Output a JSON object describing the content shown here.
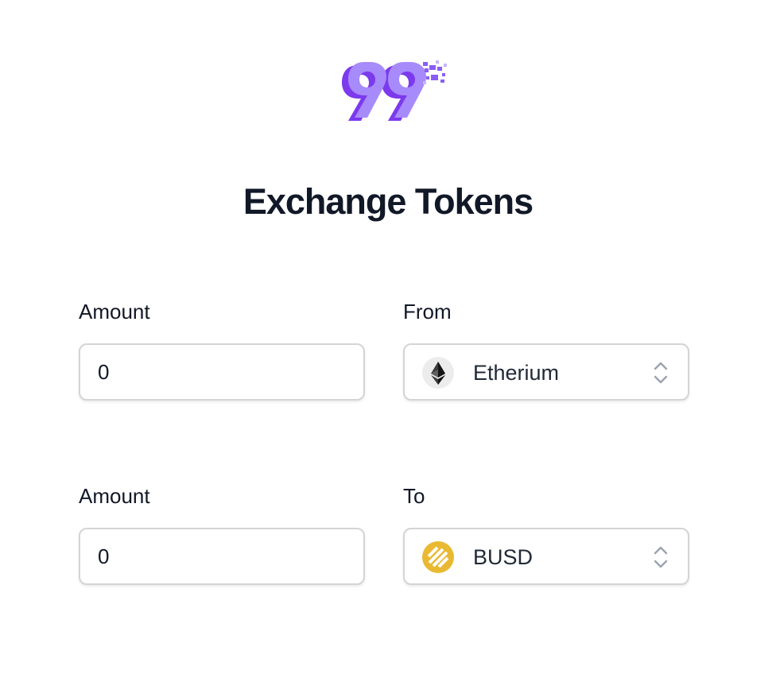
{
  "page": {
    "title": "Exchange Tokens"
  },
  "colors": {
    "brand_purple": "#8b5cf6",
    "brand_purple_dark": "#6d28d9",
    "field_border": "#d4d4d8",
    "busd_yellow": "#e9b932"
  },
  "from_row": {
    "amount_label": "Amount",
    "amount_value": "0",
    "token_label": "From",
    "token_selected": "Etherium",
    "token_icon": "ethereum-icon"
  },
  "to_row": {
    "amount_label": "Amount",
    "amount_value": "0",
    "token_label": "To",
    "token_selected": "BUSD",
    "token_icon": "busd-icon"
  }
}
